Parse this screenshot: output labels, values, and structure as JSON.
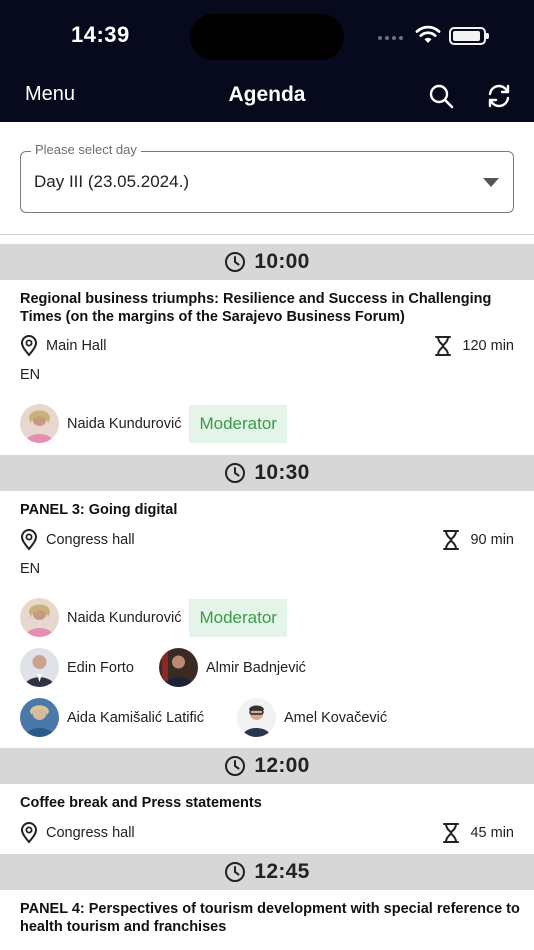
{
  "status_bar": {
    "time": "14:39"
  },
  "nav": {
    "menu_label": "Menu",
    "title": "Agenda"
  },
  "day_select": {
    "label": "Please select day",
    "value": "Day III (23.05.2024.)"
  },
  "sessions": [
    {
      "time": "10:00",
      "title": "Regional business triumphs: Resilience and Success in Challenging Times (on the margins of the Sarajevo Business Forum)",
      "location": "Main Hall",
      "duration": "120 min",
      "language": "EN",
      "speakers": [
        {
          "name": "Naida Kundurović",
          "role": "Moderator"
        }
      ]
    },
    {
      "time": "10:30",
      "title": "PANEL 3: Going digital",
      "location": "Congress hall",
      "duration": "90 min",
      "language": "EN",
      "speakers": [
        {
          "name": "Naida Kundurović",
          "role": "Moderator"
        },
        {
          "name": "Edin Forto"
        },
        {
          "name": "Almir Badnjević"
        },
        {
          "name": "Aida Kamišalić Latifić"
        },
        {
          "name": "Amel Kovačević"
        }
      ]
    },
    {
      "time": "12:00",
      "title": "Coffee break and Press statements",
      "location": "Congress hall",
      "duration": "45 min"
    },
    {
      "time": "12:45",
      "title": "PANEL 4: Perspectives of tourism development with special reference to health tourism and franchises"
    }
  ],
  "icons": {
    "search": "search-icon",
    "refresh": "refresh-icon",
    "clock": "clock-icon",
    "location": "location-pin-icon",
    "duration": "hourglass-icon",
    "dropdown": "chevron-down-icon"
  },
  "colors": {
    "header_bg": "#060a1c",
    "time_bar_bg": "#d7d7d7",
    "moderator_bg": "#e5f4e8",
    "moderator_text": "#3a9a4a"
  }
}
